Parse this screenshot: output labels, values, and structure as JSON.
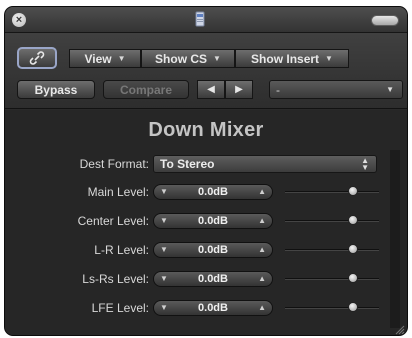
{
  "window": {
    "close_glyph": "×"
  },
  "toolbar": {
    "link_icon": "link-icon",
    "view_label": "View",
    "show_cs_label": "Show CS",
    "show_insert_label": "Show Insert",
    "bypass_label": "Bypass",
    "compare_label": "Compare",
    "prev_glyph": "◀",
    "next_glyph": "▶",
    "preset_value": "-"
  },
  "plugin": {
    "title": "Down Mixer",
    "dest_format_label": "Dest Format:",
    "dest_format_value": "To Stereo",
    "rows": [
      {
        "label": "Main Level:",
        "value": "0.0dB",
        "slider_fraction": 0.72
      },
      {
        "label": "Center Level:",
        "value": "0.0dB",
        "slider_fraction": 0.72
      },
      {
        "label": "L-R Level:",
        "value": "0.0dB",
        "slider_fraction": 0.72
      },
      {
        "label": "Ls-Rs Level:",
        "value": "0.0dB",
        "slider_fraction": 0.72
      },
      {
        "label": "LFE Level:",
        "value": "0.0dB",
        "slider_fraction": 0.72
      }
    ]
  },
  "colors": {
    "window_bg": "#262626",
    "title_text": "#c4c4c4",
    "label_text": "#d8d8d8"
  }
}
